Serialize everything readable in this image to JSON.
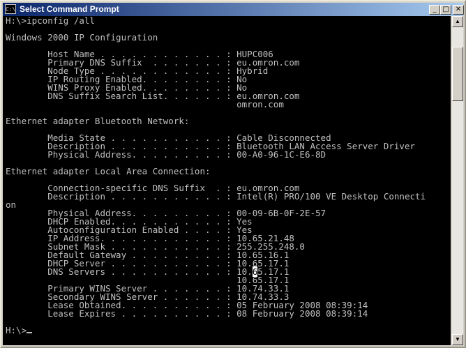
{
  "window": {
    "title": "Select Command Prompt",
    "icon": "C:\\",
    "buttons": {
      "minimize": "_",
      "maximize": "□",
      "close": "✕"
    }
  },
  "console": {
    "lines": [
      "H:\\>ipconfig /all",
      "",
      "Windows 2000 IP Configuration",
      "",
      "        Host Name . . . . . . . . . . . . : HUPC006",
      "        Primary DNS Suffix  . . . . . . . : eu.omron.com",
      "        Node Type . . . . . . . . . . . . : Hybrid",
      "        IP Routing Enabled. . . . . . . . : No",
      "        WINS Proxy Enabled. . . . . . . . : No",
      "        DNS Suffix Search List. . . . . . : eu.omron.com",
      "                                            omron.com",
      "",
      "Ethernet adapter Bluetooth Network:",
      "",
      "        Media State . . . . . . . . . . . : Cable Disconnected",
      "        Description . . . . . . . . . . . : Bluetooth LAN Access Server Driver",
      "        Physical Address. . . . . . . . . : 00-A0-96-1C-E6-8D",
      "",
      "Ethernet adapter Local Area Connection:",
      "",
      "        Connection-specific DNS Suffix  . : eu.omron.com",
      "        Description . . . . . . . . . . . : Intel(R) PRO/100 VE Desktop Connecti",
      "on",
      "        Physical Address. . . . . . . . . : 00-09-6B-0F-2E-57",
      "        DHCP Enabled. . . . . . . . . . . : Yes",
      "        Autoconfiguration Enabled . . . . : Yes",
      "        IP Address. . . . . . . . . . . . : 10.65.21.48",
      "        Subnet Mask . . . . . . . . . . . : 255.255.248.0",
      "        Default Gateway . . . . . . . . . : 10.65.16.1",
      "        DHCP Server . . . . . . . . . . . : 10.65.17.1",
      "        DNS Servers . . . . . . . . . . . : 10.65.17.1",
      "                                            10.65.17.1",
      "        Primary WINS Server . . . . . . . : 10.74.33.1",
      "        Secondary WINS Server . . . . . . : 10.74.33.3",
      "        Lease Obtained. . . . . . . . . . : 05 February 2008 08:39:14",
      "        Lease Expires . . . . . . . . . . : 08 February 2008 08:39:14",
      "",
      "H:\\>"
    ],
    "selection": {
      "line": 30,
      "char": 47
    }
  },
  "colors": {
    "title_start": "#0a246a",
    "title_end": "#a6caf0",
    "console_bg": "#000000",
    "console_fg": "#c0c0c0"
  }
}
